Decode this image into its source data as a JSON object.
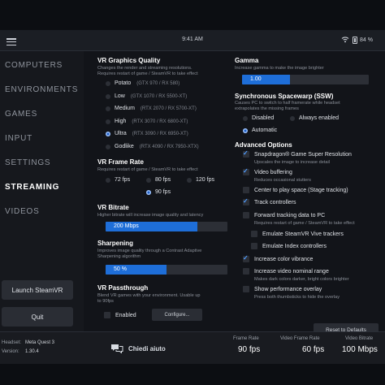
{
  "status_bar": {
    "time": "9:41 AM",
    "battery": "84 %"
  },
  "sidebar": {
    "items": [
      {
        "label": "COMPUTERS"
      },
      {
        "label": "ENVIRONMENTS"
      },
      {
        "label": "GAMES"
      },
      {
        "label": "INPUT"
      },
      {
        "label": "SETTINGS"
      },
      {
        "label": "STREAMING",
        "active": true
      },
      {
        "label": "VIDEOS"
      }
    ],
    "launch_button": "Launch SteamVR",
    "quit_button": "Quit"
  },
  "graphics": {
    "title": "VR Graphics Quality",
    "desc_1": "Changes the render and streaming resolutions.",
    "desc_2": "Requires restart of game / SteamVR to take effect",
    "options": [
      {
        "label": "Potato",
        "hint": "(GTX 970 / RX 580)"
      },
      {
        "label": "Low",
        "hint": "(GTX 1070 / RX 5500-XT)"
      },
      {
        "label": "Medium",
        "hint": "(RTX 2070 / RX 5700-XT)"
      },
      {
        "label": "High",
        "hint": "(RTX 3070 / RX 6800-XT)"
      },
      {
        "label": "Ultra",
        "hint": "(RTX 3090 / RX 6950-XT)",
        "selected": true
      },
      {
        "label": "Godlike",
        "hint": "(RTX 4090 / RX 7950-XTX)"
      }
    ]
  },
  "frame_rate": {
    "title": "VR Frame Rate",
    "desc": "Requires restart of game / SteamVR to take effect",
    "options": [
      {
        "label": "72 fps"
      },
      {
        "label": "80 fps"
      },
      {
        "label": "120 fps"
      },
      {
        "label": "90 fps",
        "selected": true
      }
    ]
  },
  "bitrate": {
    "title": "VR Bitrate",
    "desc": "Higher bitrate will increase image quality and latency",
    "value": "200 Mbps",
    "fill_fraction": 0.75
  },
  "sharpening": {
    "title": "Sharpening",
    "desc_1": "Improves image quality through a Contrast Adaptive",
    "desc_2": "Sharpening algorithm",
    "value": "50 %",
    "fill_fraction": 0.5
  },
  "passthrough": {
    "title": "VR Passthrough",
    "desc_1": "Blend VR games with your environment. Usable up",
    "desc_2": "to 90fps",
    "enabled_label": "Enabled",
    "configure_label": "Configure..."
  },
  "gamma": {
    "title": "Gamma",
    "desc": "Increase gamma to make the image brighter",
    "value": "1.00",
    "fill_fraction": 0.38
  },
  "ssw": {
    "title": "Synchronous Spacewarp (SSW)",
    "desc_1": "Causes PC to switch to half framerate while headset",
    "desc_2": "extrapolates the missing frames",
    "options": [
      {
        "label": "Disabled"
      },
      {
        "label": "Always enabled"
      },
      {
        "label": "Automatic",
        "selected": true
      }
    ]
  },
  "advanced": {
    "title": "Advanced Options",
    "items": [
      {
        "label": "Snapdragon® Game Super Resolution",
        "checked": true,
        "desc": "Upscales the image to increase detail"
      },
      {
        "label": "Video buffering",
        "checked": true,
        "desc": "Reduces occasional stutters"
      },
      {
        "label": "Center to play space (Stage tracking)",
        "checked": false
      },
      {
        "label": "Track controllers",
        "checked": true
      },
      {
        "label": "Forward tracking data to PC",
        "checked": false,
        "desc": "Requires restart of game / SteamVR to take effect"
      },
      {
        "label": "Emulate SteamVR Vive trackers",
        "checked": false
      },
      {
        "label": "Emulate Index controllers",
        "checked": false
      },
      {
        "label": "Increase color vibrance",
        "checked": true
      },
      {
        "label": "Increase video nominal range",
        "checked": false,
        "desc": "Makes dark colors darker, bright colors brighter"
      },
      {
        "label": "Show performance overlay",
        "checked": false,
        "desc": "Press both thumbsticks to hide the overlay"
      }
    ],
    "reset_button": "Reset to Defaults"
  },
  "bottom_bar": {
    "headset_label": "Headset:",
    "headset_value": "Meta Quest 3",
    "version_label": "Version:",
    "version_value": "1.30.4",
    "help_label": "Chiedi aiuto",
    "frame_rate_label": "Frame Rate",
    "frame_rate_value": "90 fps",
    "video_frame_rate_label": "Video Frame Rate",
    "video_frame_rate_value": "60 fps",
    "video_bitrate_label": "Video Bitrate",
    "video_bitrate_value": "100 Mbps"
  },
  "colors": {
    "accent": "#1e6ed8",
    "background": "#121419",
    "sidebar": "#16181d"
  }
}
